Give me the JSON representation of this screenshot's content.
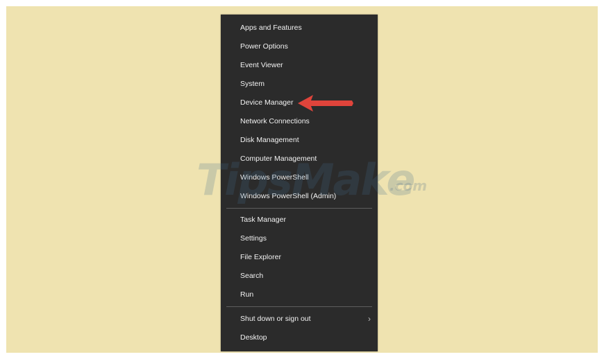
{
  "menu": {
    "items": [
      {
        "label": "Apps and Features"
      },
      {
        "label": "Power Options"
      },
      {
        "label": "Event Viewer"
      },
      {
        "label": "System"
      },
      {
        "label": "Device Manager"
      },
      {
        "label": "Network Connections"
      },
      {
        "label": "Disk Management"
      },
      {
        "label": "Computer Management"
      },
      {
        "label": "Windows PowerShell"
      },
      {
        "label": "Windows PowerShell (Admin)"
      },
      {
        "label": "Task Manager"
      },
      {
        "label": "Settings"
      },
      {
        "label": "File Explorer"
      },
      {
        "label": "Search"
      },
      {
        "label": "Run"
      },
      {
        "label": "Shut down or sign out"
      },
      {
        "label": "Desktop"
      }
    ],
    "submenu_chevron": "›"
  },
  "watermark": {
    "main": "TipsMake",
    "sub": ".com"
  },
  "colors": {
    "background": "#efe3b0",
    "menu": "#2b2b2b",
    "arrow": "#e0443b"
  },
  "icons": {
    "annotation": "left-arrow-icon",
    "submenu": "chevron-right-icon"
  }
}
